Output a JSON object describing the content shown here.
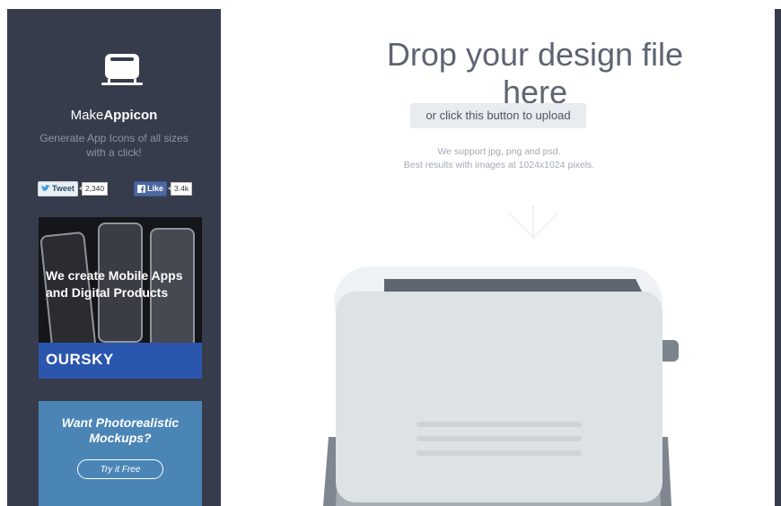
{
  "sidebar": {
    "brand_prefix": "Make",
    "brand_bold": "Appicon",
    "tagline": "Generate App Icons of all sizes with a click!",
    "tweet_label": "Tweet",
    "tweet_count": "2,340",
    "like_label": "Like",
    "like_count": "3.4k"
  },
  "ad_oursky": {
    "headline": "We create Mobile Apps and Digital Products",
    "brand": "OURSKY"
  },
  "ad_mockups": {
    "headline": "Want Photorealistic Mockups?",
    "cta": "Try it Free"
  },
  "main": {
    "headline": "Drop your design file here",
    "upload_button": "or click this button to upload",
    "support_line1": "We support jpg, png and psd.",
    "support_line2": "Best results with images at 1024x1024 pixels."
  },
  "colors": {
    "sidebar_bg": "#363c4b",
    "accent_blue": "#2b56ad",
    "headline_text": "#5d6472"
  }
}
